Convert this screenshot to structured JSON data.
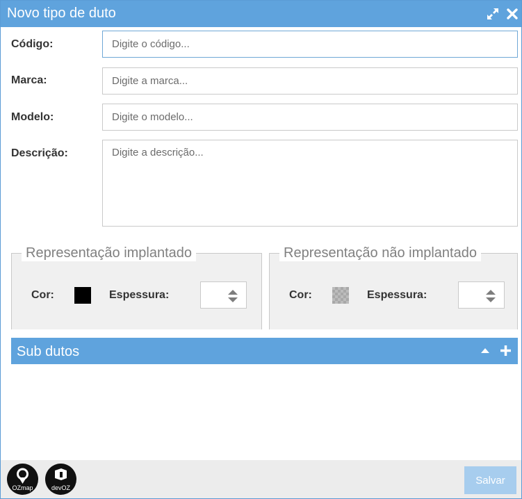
{
  "window": {
    "title": "Novo tipo de duto",
    "maximize_icon": "expand-arrows-icon",
    "close_icon": "close-x-icon"
  },
  "form": {
    "codigo": {
      "label": "Código:",
      "placeholder": "Digite o código..."
    },
    "marca": {
      "label": "Marca:",
      "placeholder": "Digite a marca..."
    },
    "modelo": {
      "label": "Modelo:",
      "placeholder": "Digite o modelo..."
    },
    "descricao": {
      "label": "Descrição:",
      "placeholder": "Digite a descrição..."
    }
  },
  "representacao_implantado": {
    "legend": "Representação implantado",
    "cor_label": "Cor:",
    "espessura_label": "Espessura:",
    "color": "#000000"
  },
  "representacao_nao_implantado": {
    "legend": "Representação não implantado",
    "cor_label": "Cor:",
    "espessura_label": "Espessura:",
    "color": "transparent-checkered"
  },
  "sub_dutos": {
    "title": "Sub dutos",
    "collapse_icon": "caret-up-icon",
    "add_icon": "plus-icon"
  },
  "footer": {
    "logo_ozmap": "OZmap",
    "logo_devoz": "devOZ",
    "save_label": "Salvar"
  },
  "colors": {
    "accent": "#5fa3dd",
    "save_disabled": "#a7cdee",
    "footer_bg": "#ececec"
  }
}
